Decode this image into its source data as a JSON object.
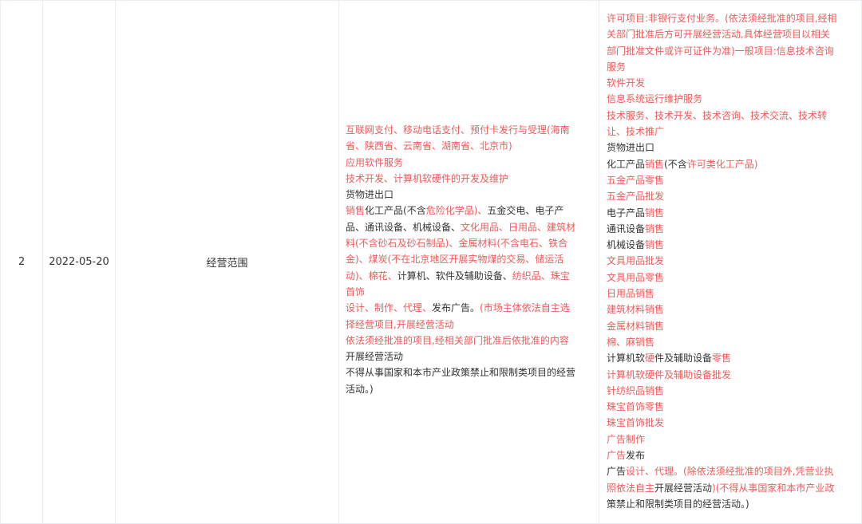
{
  "row": {
    "index": "2",
    "date": "2022-05-20",
    "item": "经营范围"
  },
  "before_lines": [
    [
      {
        "t": "互联网支付、移动电话支付、预付卡发行与受理(海南",
        "c": "red"
      }
    ],
    [
      {
        "t": "省、陕西省、云南省、湖南省、北京市)",
        "c": "red"
      }
    ],
    [
      {
        "t": "应用软件服务",
        "c": "red"
      }
    ],
    [
      {
        "t": "技术开发、计算机软硬件的开发及维护",
        "c": "red"
      }
    ],
    [
      {
        "t": "货物进出口",
        "c": "dark"
      }
    ],
    [
      {
        "t": "销售",
        "c": "red"
      },
      {
        "t": "化工产品(不含",
        "c": "dark"
      },
      {
        "t": "危险化学品)、",
        "c": "red"
      },
      {
        "t": "五金交电、",
        "c": "dark"
      },
      {
        "t": "电子产",
        "c": "dark"
      }
    ],
    [
      {
        "t": "品、通讯设备、机械设备、",
        "c": "dark"
      },
      {
        "t": "文化用品、日用品、建筑材",
        "c": "red"
      }
    ],
    [
      {
        "t": "料(不含砂石及砂石制品)、金属材料(不含电石、铁合",
        "c": "red"
      }
    ],
    [
      {
        "t": "金)、煤炭(不在北京地区开展实物煤的交易、储运活",
        "c": "red"
      }
    ],
    [
      {
        "t": "动)、棉花、",
        "c": "red"
      },
      {
        "t": "计算机、软件及辅助设备、",
        "c": "dark"
      },
      {
        "t": "纺织品、珠宝",
        "c": "red"
      }
    ],
    [
      {
        "t": "首饰",
        "c": "red"
      }
    ],
    [
      {
        "t": "设计、制作、代理、",
        "c": "red"
      },
      {
        "t": "发布广告。",
        "c": "dark"
      },
      {
        "t": "(市场主体依法自主选",
        "c": "red"
      }
    ],
    [
      {
        "t": "择经营项目,开展经营活动",
        "c": "red"
      }
    ],
    [
      {
        "t": "依法须经批准的项目,经相关部门批准后依批准的内容",
        "c": "red"
      }
    ],
    [
      {
        "t": "开展经营活动",
        "c": "dark"
      }
    ],
    [
      {
        "t": "不得从事国家和本市产业政策禁止和限制类项目的经营",
        "c": "dark"
      }
    ],
    [
      {
        "t": "活动。)",
        "c": "dark"
      }
    ]
  ],
  "after_lines": [
    [
      {
        "t": "许可项目:非银行支付业务。(依法须经批准的项目,经相",
        "c": "red"
      }
    ],
    [
      {
        "t": "关部门批准后方可开展经营活动,具体经营项目以相关",
        "c": "red"
      }
    ],
    [
      {
        "t": "部门批准文件或许可证件为准)一般项目:信息技术咨询",
        "c": "red"
      }
    ],
    [
      {
        "t": "服务",
        "c": "red"
      }
    ],
    [
      {
        "t": "软件开发",
        "c": "red"
      }
    ],
    [
      {
        "t": "信息系统运行维护服务",
        "c": "red"
      }
    ],
    [
      {
        "t": "技术服务、技术开发、技术咨询、技术交流、技术转",
        "c": "red"
      }
    ],
    [
      {
        "t": "让、技术推广",
        "c": "red"
      }
    ],
    [
      {
        "t": "货物进出口",
        "c": "dark"
      }
    ],
    [
      {
        "t": "化工产品",
        "c": "dark"
      },
      {
        "t": "销售",
        "c": "red"
      },
      {
        "t": "(不含",
        "c": "dark"
      },
      {
        "t": "许可类化工产品)",
        "c": "red"
      }
    ],
    [
      {
        "t": "五金产品零售",
        "c": "red"
      }
    ],
    [
      {
        "t": "五金产品批发",
        "c": "red"
      }
    ],
    [
      {
        "t": "电子产品",
        "c": "dark"
      },
      {
        "t": "销售",
        "c": "red"
      }
    ],
    [
      {
        "t": "通讯设备",
        "c": "dark"
      },
      {
        "t": "销售",
        "c": "red"
      }
    ],
    [
      {
        "t": "机械设备",
        "c": "dark"
      },
      {
        "t": "销售",
        "c": "red"
      }
    ],
    [
      {
        "t": "文具用品批发",
        "c": "red"
      }
    ],
    [
      {
        "t": "文具用品零售",
        "c": "red"
      }
    ],
    [
      {
        "t": "日用品销售",
        "c": "red"
      }
    ],
    [
      {
        "t": "建筑材料销售",
        "c": "red"
      }
    ],
    [
      {
        "t": "金属材料销售",
        "c": "red"
      }
    ],
    [
      {
        "t": "棉、麻销售",
        "c": "red"
      }
    ],
    [
      {
        "t": "计算机软",
        "c": "dark"
      },
      {
        "t": "硬",
        "c": "red"
      },
      {
        "t": "件及辅助设备",
        "c": "dark"
      },
      {
        "t": "零售",
        "c": "red"
      }
    ],
    [
      {
        "t": "计算机软硬件及辅助设备批发",
        "c": "red"
      }
    ],
    [
      {
        "t": "针纺织品销售",
        "c": "red"
      }
    ],
    [
      {
        "t": "珠宝首饰零售",
        "c": "red"
      }
    ],
    [
      {
        "t": "珠宝首饰批发",
        "c": "red"
      }
    ],
    [
      {
        "t": "广告制作",
        "c": "red"
      }
    ],
    [
      {
        "t": "广告",
        "c": "red"
      },
      {
        "t": "发布",
        "c": "dark"
      }
    ],
    [
      {
        "t": "广告",
        "c": "dark"
      },
      {
        "t": "设计、代理。(除依法须经批准的项目外,凭营业执",
        "c": "red"
      }
    ],
    [
      {
        "t": "照依法自主",
        "c": "red"
      },
      {
        "t": "开展经营活动",
        "c": "dark"
      },
      {
        "t": ")(不得从事国家和本市产业政",
        "c": "red"
      }
    ],
    [
      {
        "t": "策禁止和限制类项目的经营活动。)",
        "c": "dark"
      }
    ]
  ],
  "colors": {
    "changed": "#f05a5a",
    "unchanged": "#333333",
    "border": "#e8edf3"
  }
}
